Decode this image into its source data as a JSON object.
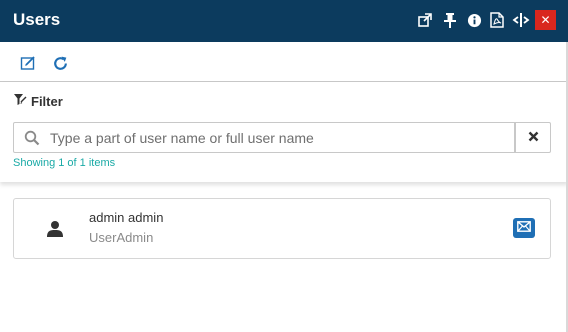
{
  "header": {
    "title": "Users",
    "icons": [
      "external-link-icon",
      "pin-icon",
      "info-icon",
      "pdf-icon",
      "resize-icon",
      "close-icon"
    ],
    "background": "#0c3b5e",
    "close_color": "#d9271e"
  },
  "toolbar": {
    "icons": [
      "edit-icon",
      "refresh-icon"
    ]
  },
  "filter": {
    "label": "Filter",
    "placeholder": "Type a part of user name or full user name",
    "value": "",
    "showing_text": "Showing 1 of 1 items"
  },
  "users": [
    {
      "name": "admin admin",
      "role": "UserAdmin",
      "icon": "person-icon",
      "action_icon": "mail-icon"
    }
  ],
  "colors": {
    "accent": "#1f6fb5",
    "status_teal": "#1aaaa6"
  }
}
